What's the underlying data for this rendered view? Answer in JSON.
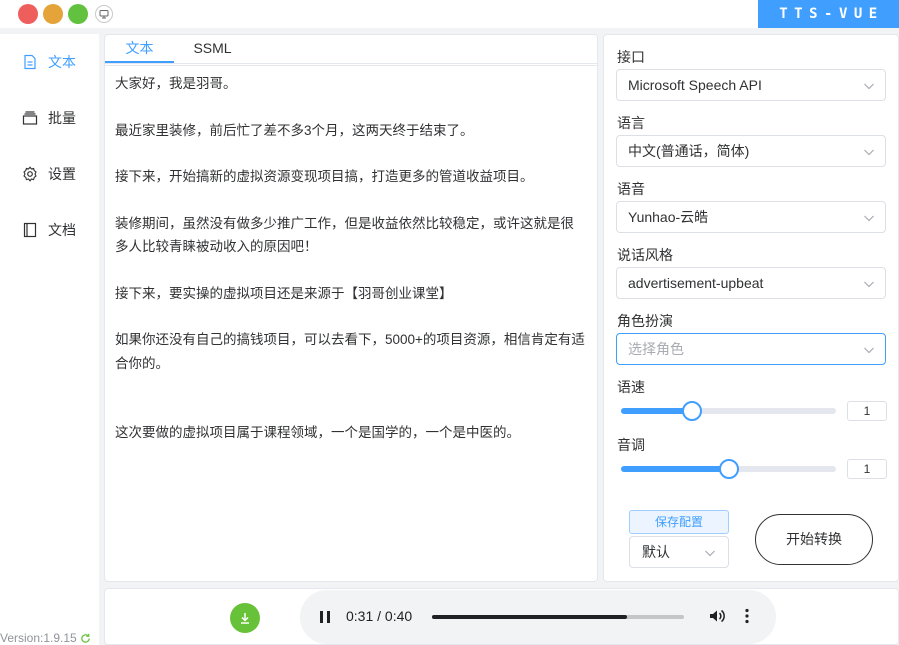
{
  "brand": "TTS-VUE",
  "version": "Version:1.9.15",
  "nav": [
    {
      "label": "文本",
      "icon": "document-icon",
      "active": true
    },
    {
      "label": "批量",
      "icon": "layers-icon",
      "active": false
    },
    {
      "label": "设置",
      "icon": "gear-icon",
      "active": false
    },
    {
      "label": "文档",
      "icon": "book-icon",
      "active": false
    }
  ],
  "editor": {
    "tabs": [
      "文本",
      "SSML"
    ],
    "text": "大家好，我是羽哥。\n\n最近家里装修，前后忙了差不多3个月，这两天终于结束了。\n\n接下来，开始搞新的虚拟资源变现项目搞，打造更多的管道收益项目。\n\n装修期间，虽然没有做多少推广工作，但是收益依然比较稳定，或许这就是很多人比较青睐被动收入的原因吧！\n\n接下来，要实操的虚拟项目还是来源于【羽哥创业课堂】\n\n如果你还没有自己的搞钱项目，可以去看下，5000+的项目资源，相信肯定有适合你的。\n\n\n这次要做的虚拟项目属于课程领域，一个是国学的，一个是中医的。"
  },
  "settings": {
    "api_label": "接口",
    "api_value": "Microsoft Speech API",
    "language_label": "语言",
    "language_value": "中文(普通话，简体)",
    "voice_label": "语音",
    "voice_value": "Yunhao-云皓",
    "style_label": "说话风格",
    "style_value": "advertisement-upbeat",
    "role_label": "角色扮演",
    "role_placeholder": "选择角色",
    "speed_label": "语速",
    "speed_value": "1",
    "speed_fraction": 0.33,
    "pitch_label": "音调",
    "pitch_value": "1",
    "pitch_fraction": 0.5,
    "save_label": "保存配置",
    "preset_value": "默认",
    "start_label": "开始转换"
  },
  "player": {
    "time": "0:31 / 0:40",
    "progress_fraction": 0.775
  },
  "colors": {
    "accent": "#409eff",
    "download": "#67c23a"
  }
}
